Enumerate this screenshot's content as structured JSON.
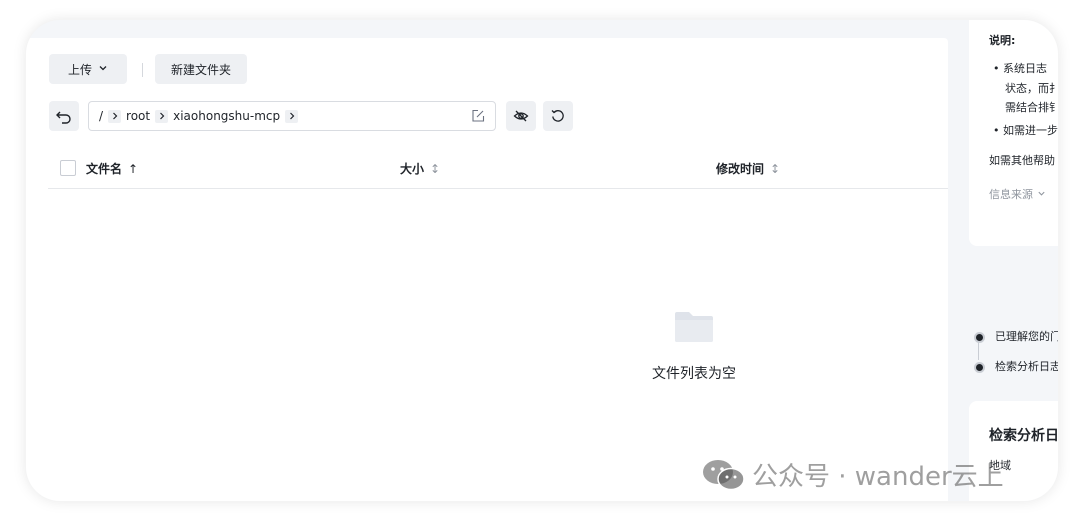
{
  "toolbar": {
    "upload_label": "上传",
    "new_folder_label": "新建文件夹"
  },
  "breadcrumb": {
    "items": [
      "/",
      "root",
      "xiaohongshu-mcp"
    ]
  },
  "table": {
    "columns": [
      {
        "label": "文件名",
        "sort": "↑"
      },
      {
        "label": "大小",
        "sort": "↕"
      },
      {
        "label": "修改时间",
        "sort": "↕"
      }
    ],
    "empty_text": "文件列表为空"
  },
  "assistant_panel": {
    "title": "说明:",
    "bullet1_line1": "系统日志",
    "bullet1_line2": "状态，而扌",
    "bullet1_line3": "需结合排钅",
    "bullet2": "如需进一步",
    "help_text": "如需其他帮助",
    "source_label": "信息来源",
    "steps": [
      "已理解您的门",
      "检索分析日志"
    ],
    "search_card_title": "检索分析日",
    "search_card_region": "地域"
  },
  "watermark": "公众号 · wander云上",
  "colors": {
    "button_bg": "#eef0f3",
    "border": "#d9dce1",
    "panel_bg": "#f4f6f9",
    "text": "#1f2329",
    "muted": "#8f959e"
  }
}
